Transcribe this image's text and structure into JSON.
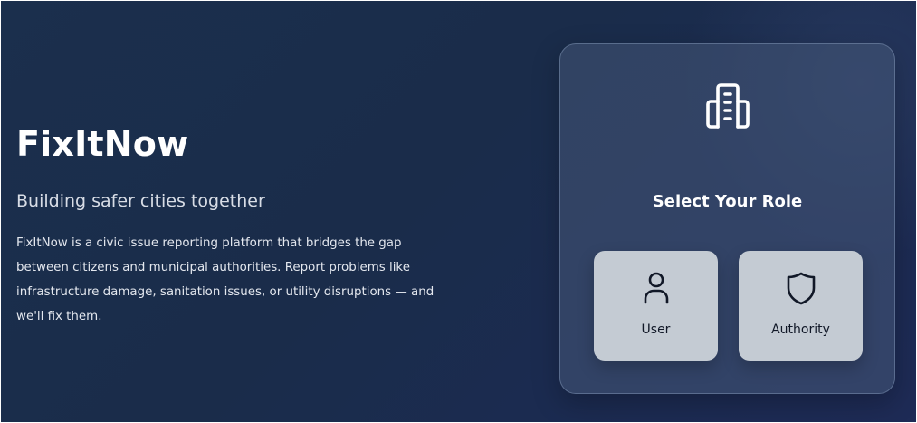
{
  "hero": {
    "title": "FixItNow",
    "tagline": "Building safer cities together",
    "description": "FixItNow is a civic issue reporting platform that bridges the gap between citizens and municipal authorities. Report problems like infrastructure damage, sanitation issues, or utility disruptions — and we'll fix them."
  },
  "role_panel": {
    "icon": "building-icon",
    "title": "Select Your Role",
    "roles": [
      {
        "label": "User",
        "icon": "user-icon"
      },
      {
        "label": "Authority",
        "icon": "shield-icon"
      }
    ]
  },
  "colors": {
    "background": "#1b2f4d",
    "panel": "#3a4a66",
    "role_button": "#c4cbd3",
    "text_primary": "#ffffff"
  }
}
